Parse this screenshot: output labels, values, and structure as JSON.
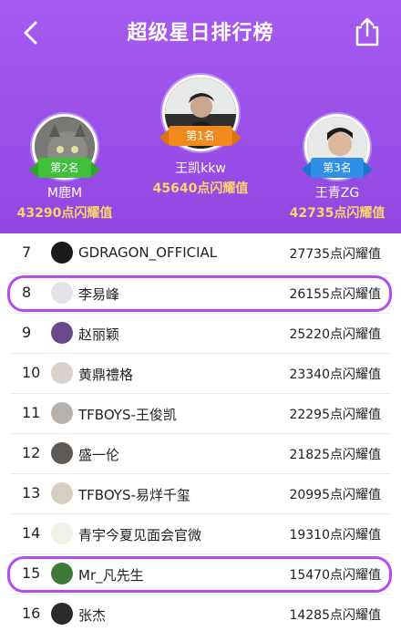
{
  "header": {
    "title": "超级星日排行榜",
    "back_icon": "chevron-left-icon",
    "share_icon": "share-icon",
    "bg_color": "#a65af0"
  },
  "podium": {
    "first": {
      "badge": "第1名",
      "name": "王凯kkw",
      "score": "45640点闪耀值"
    },
    "second": {
      "badge": "第2名",
      "name": "M鹿M",
      "score": "43290点闪耀值"
    },
    "third": {
      "badge": "第3名",
      "name": "王青ZG",
      "score": "42735点闪耀值"
    }
  },
  "list": [
    {
      "rank": "7",
      "name": "GDRAGON_OFFICIAL",
      "score": "27735点闪耀值",
      "avatar_color": "#1a1a1a"
    },
    {
      "rank": "8",
      "name": "李易峰",
      "score": "26155点闪耀值",
      "avatar_color": "#e4e4e8"
    },
    {
      "rank": "9",
      "name": "赵丽颖",
      "score": "25220点闪耀值",
      "avatar_color": "#6a4a8c"
    },
    {
      "rank": "10",
      "name": "黄鼎禮格",
      "score": "23340点闪耀值",
      "avatar_color": "#d9d2cc"
    },
    {
      "rank": "11",
      "name": "TFBOYS-王俊凯",
      "score": "22295点闪耀值",
      "avatar_color": "#b8b2ae"
    },
    {
      "rank": "12",
      "name": "盛一伦",
      "score": "21825点闪耀值",
      "avatar_color": "#5e5a58"
    },
    {
      "rank": "13",
      "name": "TFBOYS-易烊千玺",
      "score": "20995点闪耀值",
      "avatar_color": "#d7cfc2"
    },
    {
      "rank": "14",
      "name": "青宇今夏见面会官微",
      "score": "19310点闪耀值",
      "avatar_color": "#eef3e6"
    },
    {
      "rank": "15",
      "name": "Mr_凡先生",
      "score": "15470点闪耀值",
      "avatar_color": "#3f7a3a"
    },
    {
      "rank": "16",
      "name": "张杰",
      "score": "14285点闪耀值",
      "avatar_color": "#2b2b2b"
    }
  ],
  "highlight_color": "#b54af0"
}
